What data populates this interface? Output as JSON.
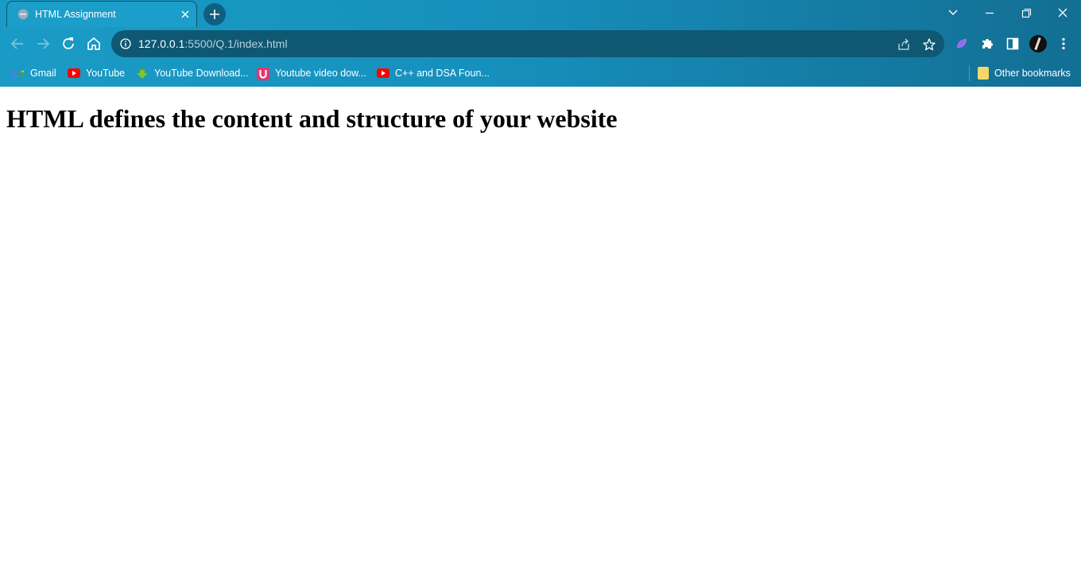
{
  "browser": {
    "tab": {
      "title": "HTML Assignment"
    },
    "omnibox": {
      "url_host": "127.0.0.1",
      "url_path": ":5500/Q.1/index.html"
    },
    "bookmarks": [
      {
        "label": "Gmail",
        "icon": "gmail-icon"
      },
      {
        "label": "YouTube",
        "icon": "youtube-icon"
      },
      {
        "label": "YouTube Download...",
        "icon": "download-icon"
      },
      {
        "label": "Youtube video dow...",
        "icon": "u-logo-icon"
      },
      {
        "label": "C++ and DSA Foun...",
        "icon": "youtube-icon"
      }
    ],
    "other_bookmarks": "Other bookmarks",
    "colors": {
      "chrome_start": "#1a9bc6",
      "chrome_end": "#136e93",
      "omnibox": "#0e5873"
    }
  },
  "page": {
    "heading": "HTML defines the content and structure of your website"
  }
}
